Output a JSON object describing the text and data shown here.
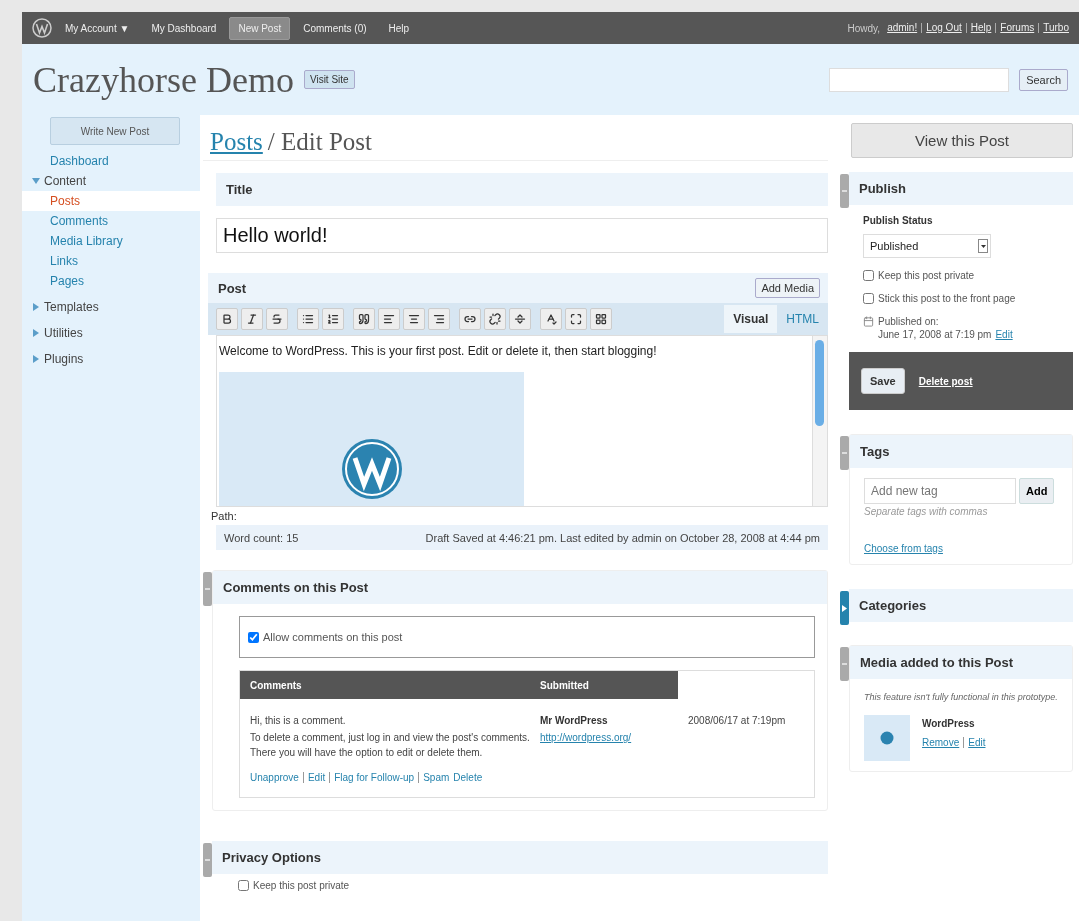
{
  "top_bar": {
    "items": [
      {
        "label": "My Account",
        "caret": "▼",
        "selected": false
      },
      {
        "label": "My Dashboard",
        "selected": false
      },
      {
        "label": "New Post",
        "selected": true
      },
      {
        "label": "Comments (0)",
        "selected": false
      },
      {
        "label": "Help",
        "selected": false
      }
    ],
    "greeting": "Howdy,",
    "user": "admin!",
    "links": [
      "Log Out",
      "Help",
      "Forums",
      "Turbo"
    ]
  },
  "header": {
    "site_title": "Crazyhorse Demo",
    "visit_site": "Visit Site",
    "search_button": "Search"
  },
  "sidebar": {
    "write_button": "Write New Post",
    "items": [
      {
        "label": "Dashboard",
        "selected": false
      },
      {
        "label": "Content",
        "selected": false,
        "expanded": true,
        "children": [
          {
            "label": "Posts",
            "selected": true
          },
          {
            "label": "Comments",
            "selected": false
          },
          {
            "label": "Media Library",
            "selected": false
          },
          {
            "label": "Links",
            "selected": false
          },
          {
            "label": "Pages",
            "selected": false
          }
        ]
      },
      {
        "label": "Templates",
        "selected": false,
        "expanded": false
      },
      {
        "label": "Utilities",
        "selected": false,
        "expanded": false
      },
      {
        "label": "Plugins",
        "selected": false,
        "expanded": false
      }
    ]
  },
  "breadcrumb": {
    "link": "Posts",
    "current": "/ Edit Post"
  },
  "view_button": "View this Post",
  "title_box": {
    "heading": "Title",
    "value": "Hello world!"
  },
  "post_box": {
    "heading": "Post",
    "add_media": "Add Media",
    "modes": [
      {
        "label": "Visual",
        "selected": true
      },
      {
        "label": "HTML",
        "selected": false
      }
    ],
    "content": "Welcome to WordPress. This is your first post. Edit or delete it, then start blogging!",
    "path_label": "Path:",
    "word_count": "Word count: 15",
    "draft_status": "Draft Saved at 4:46:21 pm. Last edited by admin on October 28, 2008 at 4:44 pm"
  },
  "comments_box": {
    "heading": "Comments on this Post",
    "expanded": true,
    "allow_comments": {
      "label": "Allow comments on this post",
      "checked": true
    },
    "columns": [
      "Comments",
      "Submitted"
    ],
    "rows": [
      {
        "lines": [
          "Hi, this is a comment.",
          "To delete a comment, just log in and view the post's comments. There you will have the option to edit or delete them."
        ],
        "actions": [
          "Unapprove",
          "Edit",
          "Flag for Follow-up",
          "Spam",
          "Delete"
        ],
        "author": "Mr WordPress",
        "url": "http://wordpress.org/",
        "date": "2008/06/17 at 7:19pm"
      }
    ]
  },
  "privacy_box": {
    "heading": "Privacy Options",
    "expanded": true,
    "options": [
      {
        "label": "Keep this post private",
        "checked": false
      }
    ]
  },
  "publish_box": {
    "heading": "Publish",
    "expanded": true,
    "status_label": "Publish Status",
    "status": "Published",
    "options": [
      {
        "label": "Keep this post private",
        "checked": false
      },
      {
        "label": "Stick this post to the front page",
        "checked": false
      }
    ],
    "published_label": "Published on:",
    "published_date": "June 17, 2008 at 7:19 pm",
    "edit_link": "Edit",
    "save": "Save",
    "delete": "Delete post"
  },
  "tags_box": {
    "heading": "Tags",
    "expanded": true,
    "placeholder": "Add new tag",
    "add": "Add",
    "hint": "Separate tags with commas",
    "choose": "Choose from tags"
  },
  "categories_box": {
    "heading": "Categories",
    "expanded": false
  },
  "media_box": {
    "heading": "Media added to this Post",
    "expanded": true,
    "note": "This feature isn't fully functional in this prototype.",
    "items": [
      {
        "name": "WordPress",
        "actions": [
          "Remove",
          "Edit"
        ]
      }
    ]
  }
}
